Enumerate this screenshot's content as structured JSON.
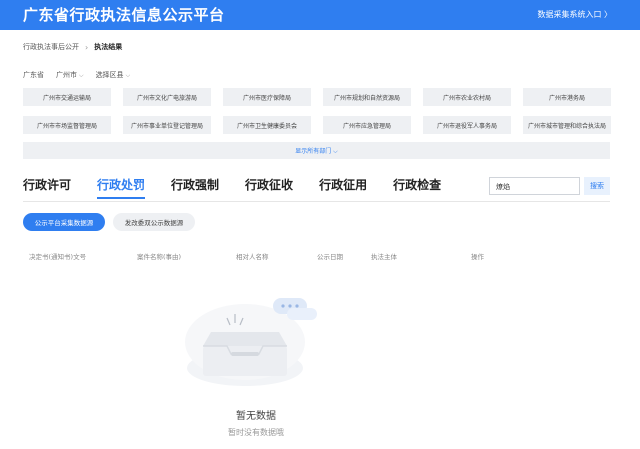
{
  "header": {
    "title": "广东省行政执法信息公示平台",
    "link": "数据采集系统入口 〉"
  },
  "breadcrumb": {
    "parent": "行政执法事后公开",
    "separator": "›",
    "current": "执法结果"
  },
  "regions": {
    "province": "广东省",
    "city": "广州市",
    "district": "选择区县"
  },
  "departments": [
    "广州市交通运输局",
    "广州市文化广电旅游局",
    "广州市医疗保障局",
    "广州市规划和自然资源局",
    "广州市农业农村局",
    "广州市港务局",
    "广州市市场监督管理局",
    "广州市事业单位登记管理局",
    "广州市卫生健康委员会",
    "广州市应急管理局",
    "广州市退役军人事务局",
    "广州市城市管理和综合执法局"
  ],
  "show_all": "显示所有部门 ⌵",
  "tabs": [
    "行政许可",
    "行政处罚",
    "行政强制",
    "行政征收",
    "行政征用",
    "行政检查"
  ],
  "active_tab": 1,
  "search": {
    "value": "燎焰",
    "button": "搜索"
  },
  "sources": {
    "active": "公示平台采集数据源",
    "inactive": "发改委双公示数据源"
  },
  "table_headers": [
    "决定书(通知书)文号",
    "案件名称(事由)",
    "相对人名称",
    "公示日期",
    "执法主体",
    "操作"
  ],
  "empty": {
    "title": "暂无数据",
    "subtitle": "暂时没有数据哦"
  },
  "colors": {
    "brand": "#2f7ef0",
    "chip_bg": "#eef0f3"
  }
}
